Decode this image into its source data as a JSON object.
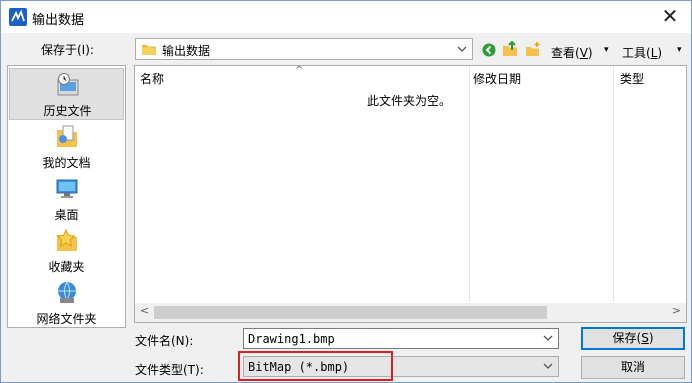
{
  "window": {
    "title": "输出数据",
    "close_glyph": "✕"
  },
  "save_in": {
    "label": "保存于(I):",
    "value": "输出数据"
  },
  "toolbar": {
    "view_label": "查看",
    "view_key": "V",
    "tools_label": "工具",
    "tools_key": "L"
  },
  "sidebar": {
    "items": [
      {
        "label": "历史文件",
        "icon": "recent-files-icon",
        "selected": true
      },
      {
        "label": "我的文档",
        "icon": "my-documents-icon",
        "selected": false
      },
      {
        "label": "桌面",
        "icon": "desktop-icon",
        "selected": false
      },
      {
        "label": "收藏夹",
        "icon": "favorites-icon",
        "selected": false
      },
      {
        "label": "网络文件夹",
        "icon": "network-folder-icon",
        "selected": false
      }
    ]
  },
  "file_list": {
    "columns": [
      "名称",
      "修改日期",
      "类型"
    ],
    "empty_message": "此文件夹为空。"
  },
  "filename": {
    "label": "文件名(N):",
    "value": "Drawing1.bmp"
  },
  "filetype": {
    "label": "文件类型(T):",
    "value": "BitMap (*.bmp)"
  },
  "buttons": {
    "save": "保存",
    "save_key": "S",
    "cancel": "取消"
  },
  "colors": {
    "accent": "#0078d7",
    "highlight_box": "#e02020"
  }
}
